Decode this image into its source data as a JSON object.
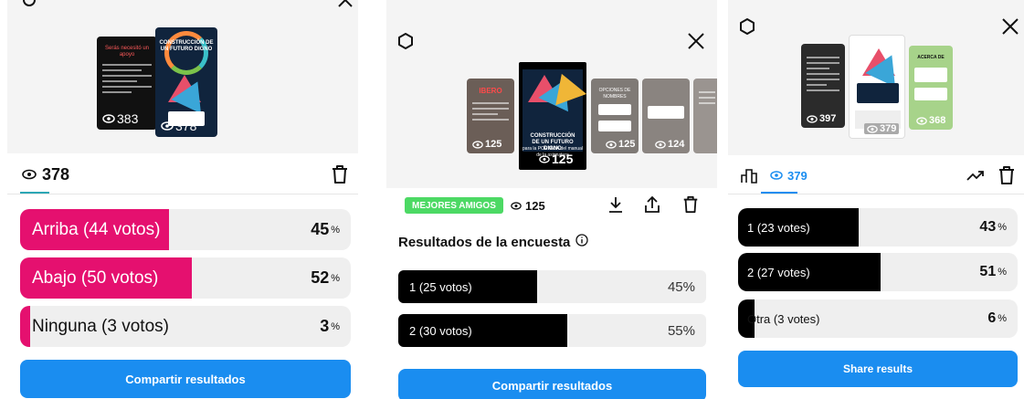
{
  "panel1": {
    "story_left_views": "383",
    "story_left_title": "Serás necesitó un apoyo",
    "story_center_title": "CONSTRUCCIÓN DE UN FUTURO DIGNO",
    "story_center_views": "378",
    "views": "378",
    "options": [
      {
        "label": "Arriba (44 votos)",
        "percent": "45",
        "fill": 0.45
      },
      {
        "label": "Abajo (50 votos)",
        "percent": "52",
        "fill": 0.52
      },
      {
        "label": "Ninguna (3 votos)",
        "percent": "3",
        "fill": 0.03
      }
    ],
    "percent_symbol": "%",
    "share_label": "Compartir resultados",
    "colors": {
      "fill": "#e5106f",
      "share": "#1a8df0"
    }
  },
  "panel2": {
    "thumbs": [
      {
        "views": "125",
        "title": "IBERO"
      },
      {
        "views": "125",
        "title": "CONSTRUCCIÓN DE UN FUTURO DIGNO",
        "caption": "para la PORTADA del manual de la asignatura"
      },
      {
        "views": "125",
        "title": "OPCIONES DE NOMBRES"
      },
      {
        "views": "124",
        "title": ""
      }
    ],
    "badge": "MEJORES AMIGOS",
    "views": "125",
    "results_title": "Resultados de la encuesta",
    "options": [
      {
        "label": "1 (25 votos)",
        "percent": "45%",
        "fill": 0.45
      },
      {
        "label": "2 (30 votos)",
        "percent": "55%",
        "fill": 0.55
      }
    ],
    "share_label": "Compartir resultados",
    "colors": {
      "badge": "#4cd964",
      "fill": "#000000",
      "share": "#1a8df0"
    }
  },
  "panel3": {
    "thumbs": [
      {
        "views": "397"
      },
      {
        "views": "379"
      },
      {
        "views": "368",
        "title": "ACERCA DE"
      }
    ],
    "views": "379",
    "options": [
      {
        "label": "1 (23 votes)",
        "percent": "43",
        "fill": 0.43
      },
      {
        "label": "2 (27 votes)",
        "percent": "51",
        "fill": 0.51
      },
      {
        "label": "Otra (3 votes)",
        "percent": "6",
        "fill": 0.06
      }
    ],
    "percent_symbol": "%",
    "share_label": "Share results",
    "colors": {
      "fill": "#000000",
      "accent": "#1a8df0",
      "share": "#1a8df0"
    }
  },
  "icons": [
    "eye-icon",
    "trash-icon",
    "close-icon",
    "settings-icon",
    "download-icon",
    "share-icon",
    "info-icon",
    "chart-icon",
    "trending-icon"
  ]
}
